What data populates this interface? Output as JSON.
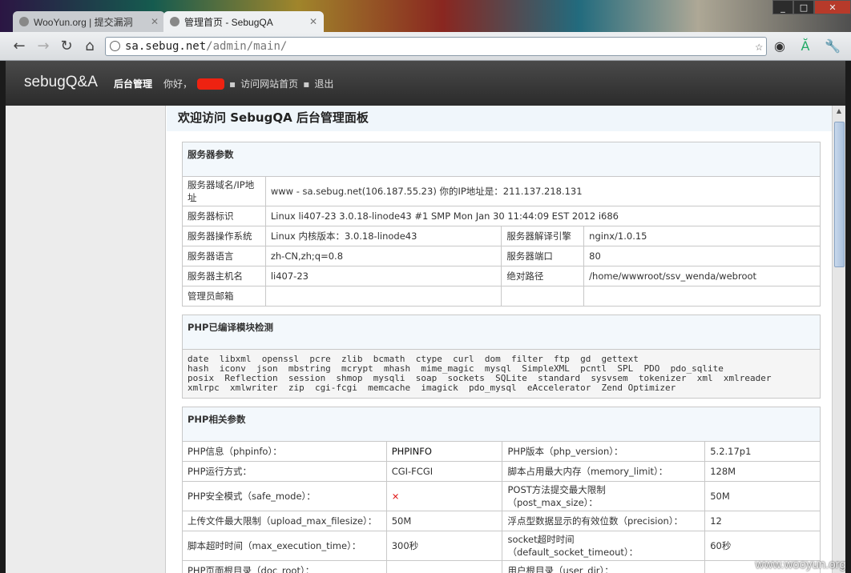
{
  "browser": {
    "tabs": [
      {
        "label": "WooYun.org | 提交漏洞",
        "active": false
      },
      {
        "label": "管理首页 - SebugQA",
        "active": true
      }
    ],
    "window_buttons": [
      "_",
      "□",
      "✕"
    ],
    "url_host": "sa.sebug.net",
    "url_path": "/admin/main/"
  },
  "header": {
    "logo": "sebugQ&A",
    "section": "后台管理",
    "greeting": "你好，",
    "link_visit": "访问网站首页",
    "link_logout": "退出"
  },
  "page_title": "欢迎访问 SebugQA 后台管理面板",
  "server": {
    "heading": "服务器参数",
    "domain_label": "服务器域名/IP地址",
    "domain_value": "www - sa.sebug.net(106.187.55.23)  你的IP地址是：211.137.218.131",
    "id_label": "服务器标识",
    "id_value": "Linux li407-23 3.0.18-linode43 #1 SMP Mon Jan 30 11:44:09 EST 2012 i686",
    "os_label": "服务器操作系统",
    "os_value": "Linux  内核版本：3.0.18-linode43",
    "engine_label": "服务器解译引擎",
    "engine_value": "nginx/1.0.15",
    "lang_label": "服务器语言",
    "lang_value": "zh-CN,zh;q=0.8",
    "port_label": "服务器端口",
    "port_value": "80",
    "host_label": "服务器主机名",
    "host_value": "li407-23",
    "path_label": "绝对路径",
    "path_value": "/home/wwwroot/ssv_wenda/webroot",
    "admin_email_label": "管理员邮箱",
    "admin_email_value": ""
  },
  "modules": {
    "heading": "PHP已编译模块检测",
    "line1": "date  libxml  openssl  pcre  zlib  bcmath  ctype  curl  dom  filter  ftp  gd  gettext",
    "line2": "hash  iconv  json  mbstring  mcrypt  mhash  mime_magic  mysql  SimpleXML  pcntl  SPL  PDO  pdo_sqlite",
    "line3": "posix  Reflection  session  shmop  mysqli  soap  sockets  SQLite  standard  sysvsem  tokenizer  xml  xmlreader",
    "line4": "xmlrpc  xmlwriter  zip  cgi-fcgi  memcache  imagick  pdo_mysql  eAccelerator  Zend Optimizer"
  },
  "php": {
    "heading": "PHP相关参数",
    "rows": [
      {
        "l1": "PHP信息（phpinfo）：",
        "v1": "PHPINFO",
        "l2": "PHP版本（php_version）：",
        "v2": "5.2.17p1"
      },
      {
        "l1": "PHP运行方式：",
        "v1": "CGI-FCGI",
        "l2": "脚本占用最大内存（memory_limit）：",
        "v2": "128M"
      },
      {
        "l1": "PHP安全模式（safe_mode）：",
        "v1": "×",
        "l2": "POST方法提交最大限制",
        "l2b": "（post_max_size）：",
        "v2": "50M"
      },
      {
        "l1": "上传文件最大限制（upload_max_filesize）：",
        "v1": "50M",
        "l2": "浮点型数据显示的有效位数（precision）：",
        "v2": "12"
      },
      {
        "l1": "脚本超时时间（max_execution_time）：",
        "v1": "300秒",
        "l2": "socket超时时间",
        "l2b": "（default_socket_timeout）：",
        "v2": "60秒"
      },
      {
        "l1": "PHP页面根目录（doc_root）：",
        "v1": "",
        "l2": "用户根目录（user_dir）：",
        "v2": ""
      }
    ]
  },
  "watermark": "www.wooyun.org"
}
